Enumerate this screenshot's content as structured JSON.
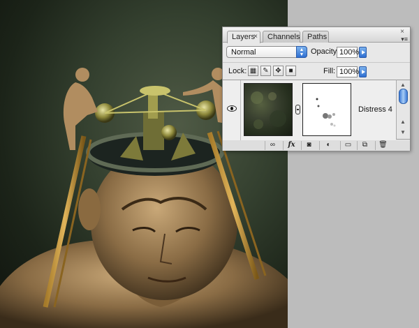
{
  "palette": {
    "tabs": [
      {
        "label": "Layers",
        "close_glyph": "×"
      },
      {
        "label": "Channels"
      },
      {
        "label": "Paths"
      }
    ],
    "window_close_glyph": "×",
    "menu_glyph": "▾≡",
    "blend_mode": "Normal",
    "opacity_label": "Opacity:",
    "opacity_value": "100%",
    "lock_label": "Lock:",
    "fill_label": "Fill:",
    "fill_value": "100%",
    "layer": {
      "name": "Distress 4",
      "visible": true
    },
    "bottom_bar": {
      "fx_label": "fx"
    }
  },
  "icons": {
    "close": "close-icon",
    "eye": "eye-icon",
    "chain": "chain-link-icon",
    "trash": "trash-icon"
  },
  "colors": {
    "accent": "#2e6fd1",
    "canvas_green": "#34402f"
  }
}
